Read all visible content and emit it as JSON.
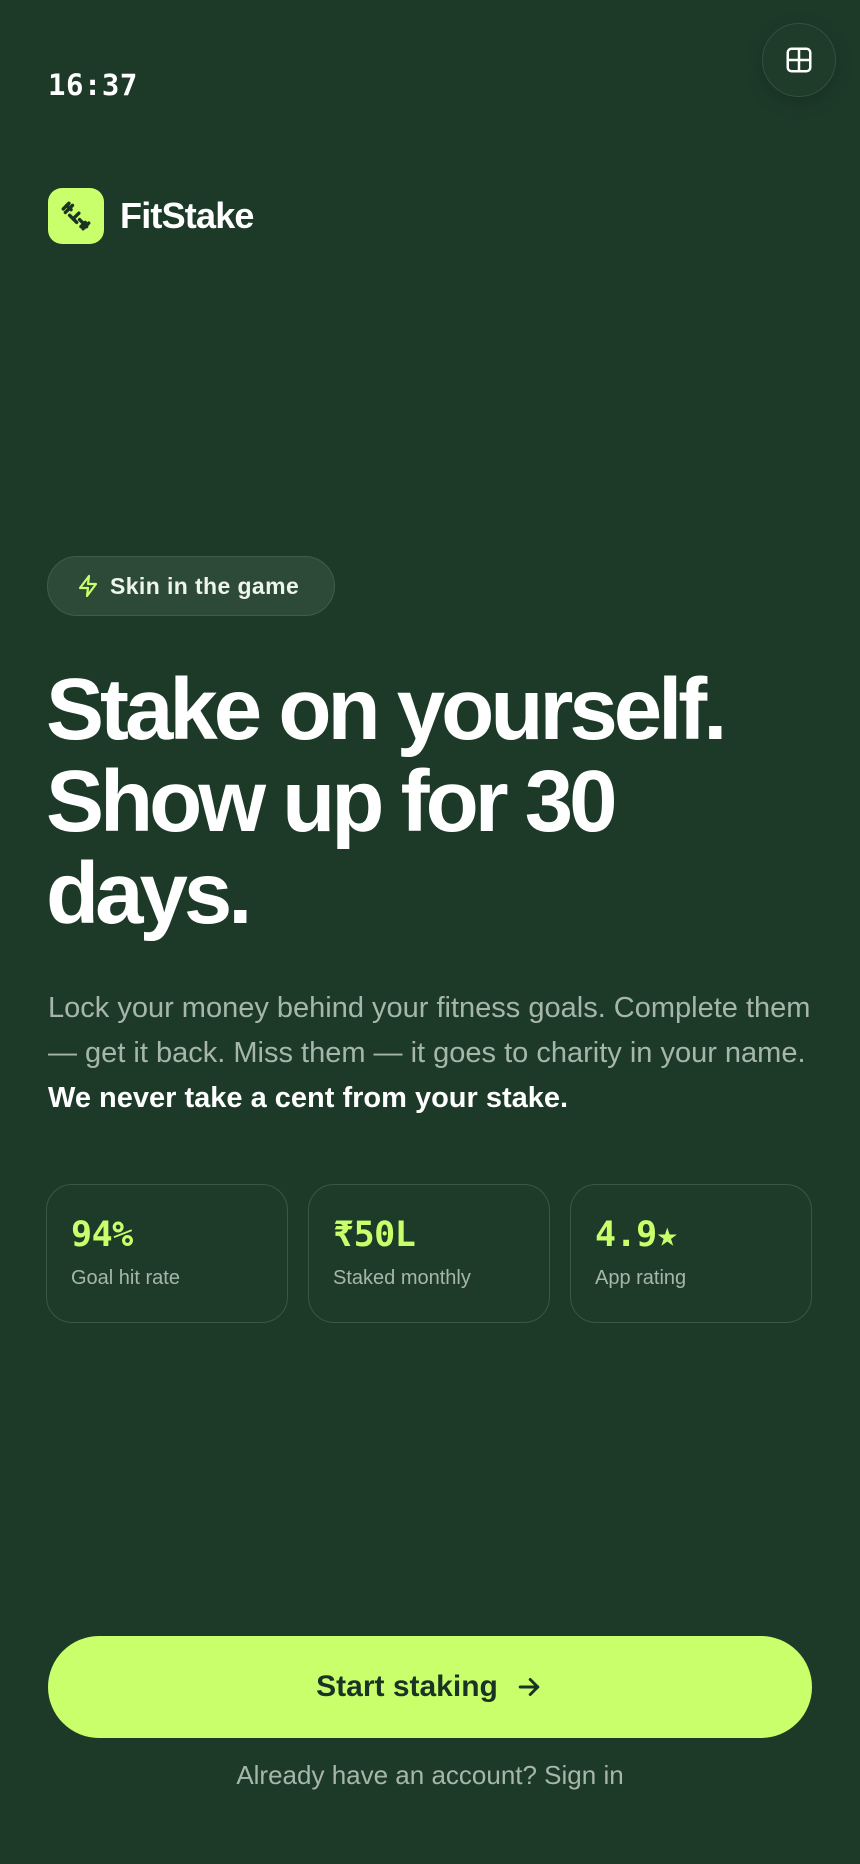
{
  "status_bar": {
    "time": "16:37"
  },
  "header": {
    "menu_icon": "grid-icon"
  },
  "brand": {
    "name": "FitStake",
    "logo_icon": "dumbbell-icon"
  },
  "badge": {
    "icon": "lightning-icon",
    "label": "Skin in the game"
  },
  "hero": {
    "headline": "Stake on yourself. Show up for 30 days.",
    "description": "Lock your money behind your fitness goals. Complete them — get it back. Miss them — it goes to charity in your name.",
    "description_emphasis": "We never take a cent from your stake."
  },
  "stats": [
    {
      "value": "94%",
      "label": "Goal hit rate"
    },
    {
      "value": "₹50L",
      "label": "Staked monthly"
    },
    {
      "value": "4.9★",
      "label": "App rating"
    }
  ],
  "cta": {
    "label": "Start staking",
    "icon": "arrow-right-icon"
  },
  "footer": {
    "signin_text": "Already have an account? Sign in"
  },
  "colors": {
    "background": "#1d3a29",
    "accent": "#c8ff6a",
    "muted_text": "#a6b7aa",
    "card_border": "#3a5744"
  }
}
